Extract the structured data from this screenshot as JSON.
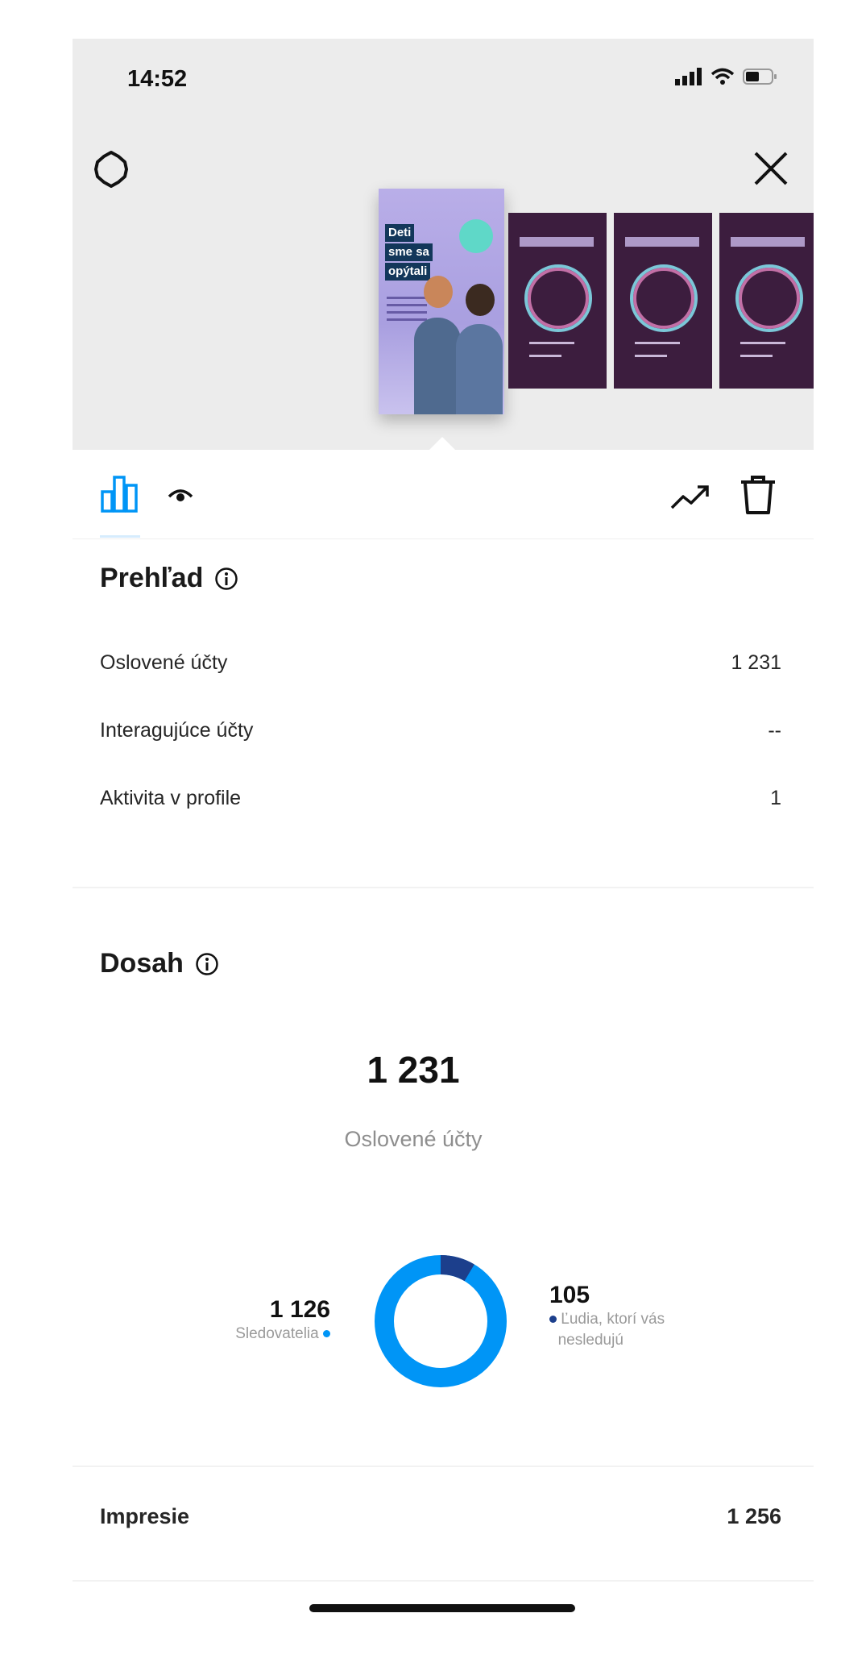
{
  "status_bar": {
    "time": "14:52"
  },
  "preview": {
    "selected_story": {
      "tag_lines": [
        "Deti",
        "sme sa",
        "opýtali"
      ]
    }
  },
  "overview": {
    "title": "Prehľad",
    "rows": [
      {
        "label": "Oslovené účty",
        "value": "1 231"
      },
      {
        "label": "Interagujúce účty",
        "value": "--"
      },
      {
        "label": "Aktivita v profile",
        "value": "1"
      }
    ]
  },
  "reach": {
    "title": "Dosah",
    "total": "1 231",
    "total_label": "Oslovené účty",
    "followers": {
      "value": "1 126",
      "label": "Sledovatelia",
      "amount": 1126,
      "color": "#0095f6"
    },
    "non_followers": {
      "value": "105",
      "label_line1": "Ľudia, ktorí vás",
      "label_line2": "nesledujú",
      "amount": 105,
      "color": "#1c3f8c"
    }
  },
  "impressions": {
    "label": "Impresie",
    "value": "1 256"
  },
  "colors": {
    "accent": "#0095f6",
    "dark_accent": "#1c3f8c"
  }
}
